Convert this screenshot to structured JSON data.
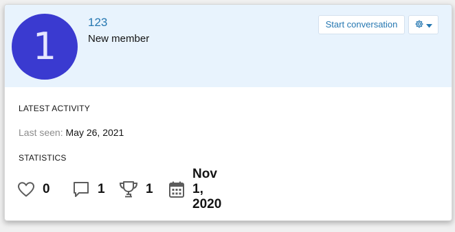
{
  "profile": {
    "avatar_letter": "1",
    "username": "123",
    "user_title": "New member",
    "avatar_color": "#3a3ad0"
  },
  "actions": {
    "start_conversation_label": "Start conversation",
    "settings_icon": "gear-icon",
    "dropdown_icon": "caret-down-icon"
  },
  "activity": {
    "section_label": "LATEST ACTIVITY",
    "last_seen_label": "Last seen",
    "last_seen_value": "May 26, 2021"
  },
  "statistics": {
    "section_label": "STATISTICS",
    "reactions": "0",
    "messages": "1",
    "trophies": "1",
    "joined": "Nov 1, 2020"
  },
  "colors": {
    "header_bg": "#e8f3fd",
    "link": "#2577b1"
  }
}
